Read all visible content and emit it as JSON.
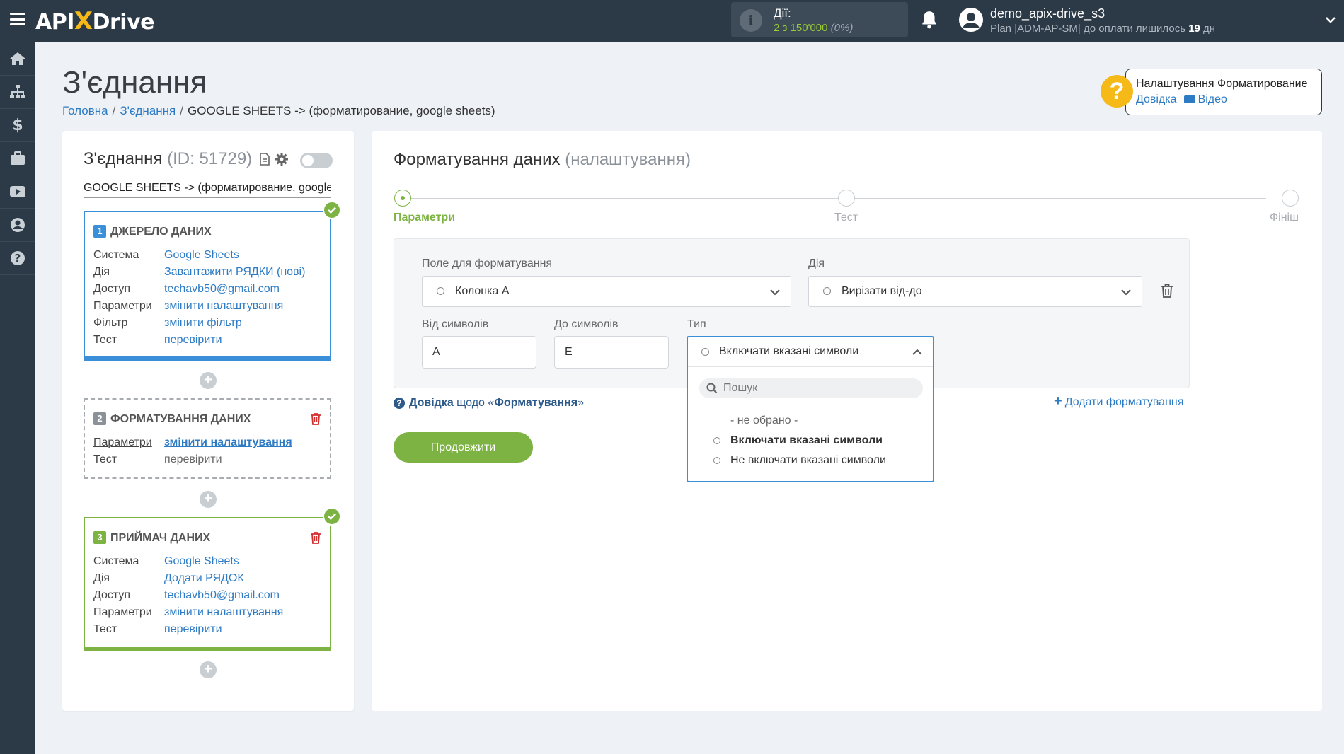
{
  "topbar": {
    "logo_prefix": "API",
    "logo_x": "X",
    "logo_suffix": "Drive",
    "actions_label": "Дії:",
    "actions_count": "2 з 150'000",
    "actions_percent": "(0%)",
    "user_name": "demo_apix-drive_s3",
    "user_plan": "Plan |ADM-AP-SM| до оплати лишилось",
    "user_days": "19",
    "user_days_unit": "дн"
  },
  "page": {
    "title": "З'єднання",
    "breadcrumb": [
      "Головна",
      "З'єднання",
      "GOOGLE SHEETS -> (форматирование, google sheets)"
    ]
  },
  "help": {
    "title": "Налаштування Форматирование",
    "link_help": "Довідка",
    "link_video": "Відео"
  },
  "connection": {
    "title": "З'єднання",
    "id": "(ID: 51729)",
    "subtitle": "GOOGLE SHEETS -> (форматирование, google sheets)",
    "source": {
      "num": "1",
      "header": "ДЖЕРЕЛО ДАНИХ",
      "rows": [
        {
          "k": "Система",
          "v": "Google Sheets"
        },
        {
          "k": "Дія",
          "v": "Завантажити РЯДКИ (нові)"
        },
        {
          "k": "Доступ",
          "v": "techavb50@gmail.com"
        },
        {
          "k": "Параметри",
          "v": "змінити налаштування"
        },
        {
          "k": "Фільтр",
          "v": "змінити фільтр"
        },
        {
          "k": "Тест",
          "v": "перевірити"
        }
      ]
    },
    "formatting": {
      "num": "2",
      "header": "ФОРМАТУВАННЯ ДАНИХ",
      "rows": [
        {
          "k": "Параметри",
          "v": "змінити налаштування"
        },
        {
          "k": "Тест",
          "v": "перевірити"
        }
      ]
    },
    "receiver": {
      "num": "3",
      "header": "ПРИЙМАЧ ДАНИХ",
      "rows": [
        {
          "k": "Система",
          "v": "Google Sheets"
        },
        {
          "k": "Дія",
          "v": "Додати РЯДОК"
        },
        {
          "k": "Доступ",
          "v": "techavb50@gmail.com"
        },
        {
          "k": "Параметри",
          "v": "змінити налаштування"
        },
        {
          "k": "Тест",
          "v": "перевірити"
        }
      ]
    }
  },
  "main": {
    "title": "Форматування даних",
    "title_suffix": "(налаштування)",
    "steps": [
      "Параметри",
      "Тест",
      "Фініш"
    ],
    "field_label": "Поле для форматування",
    "field_value": "Колонка A",
    "action_label": "Дія",
    "action_value": "Вирізати від-до",
    "from_label": "Від символів",
    "from_value": "A",
    "to_label": "До символів",
    "to_value": "E",
    "type_label": "Тип",
    "type_value": "Включати вказані символи",
    "search_placeholder": "Пошук",
    "options": [
      "- не обрано -",
      "Включати вказані символи",
      "Не включати вказані символи"
    ],
    "help_prefix": "Довідка",
    "help_middle": "щодо «",
    "help_bold": "Форматування",
    "help_end": "»",
    "add_formatting": "Додати форматування",
    "continue": "Продовжити"
  }
}
